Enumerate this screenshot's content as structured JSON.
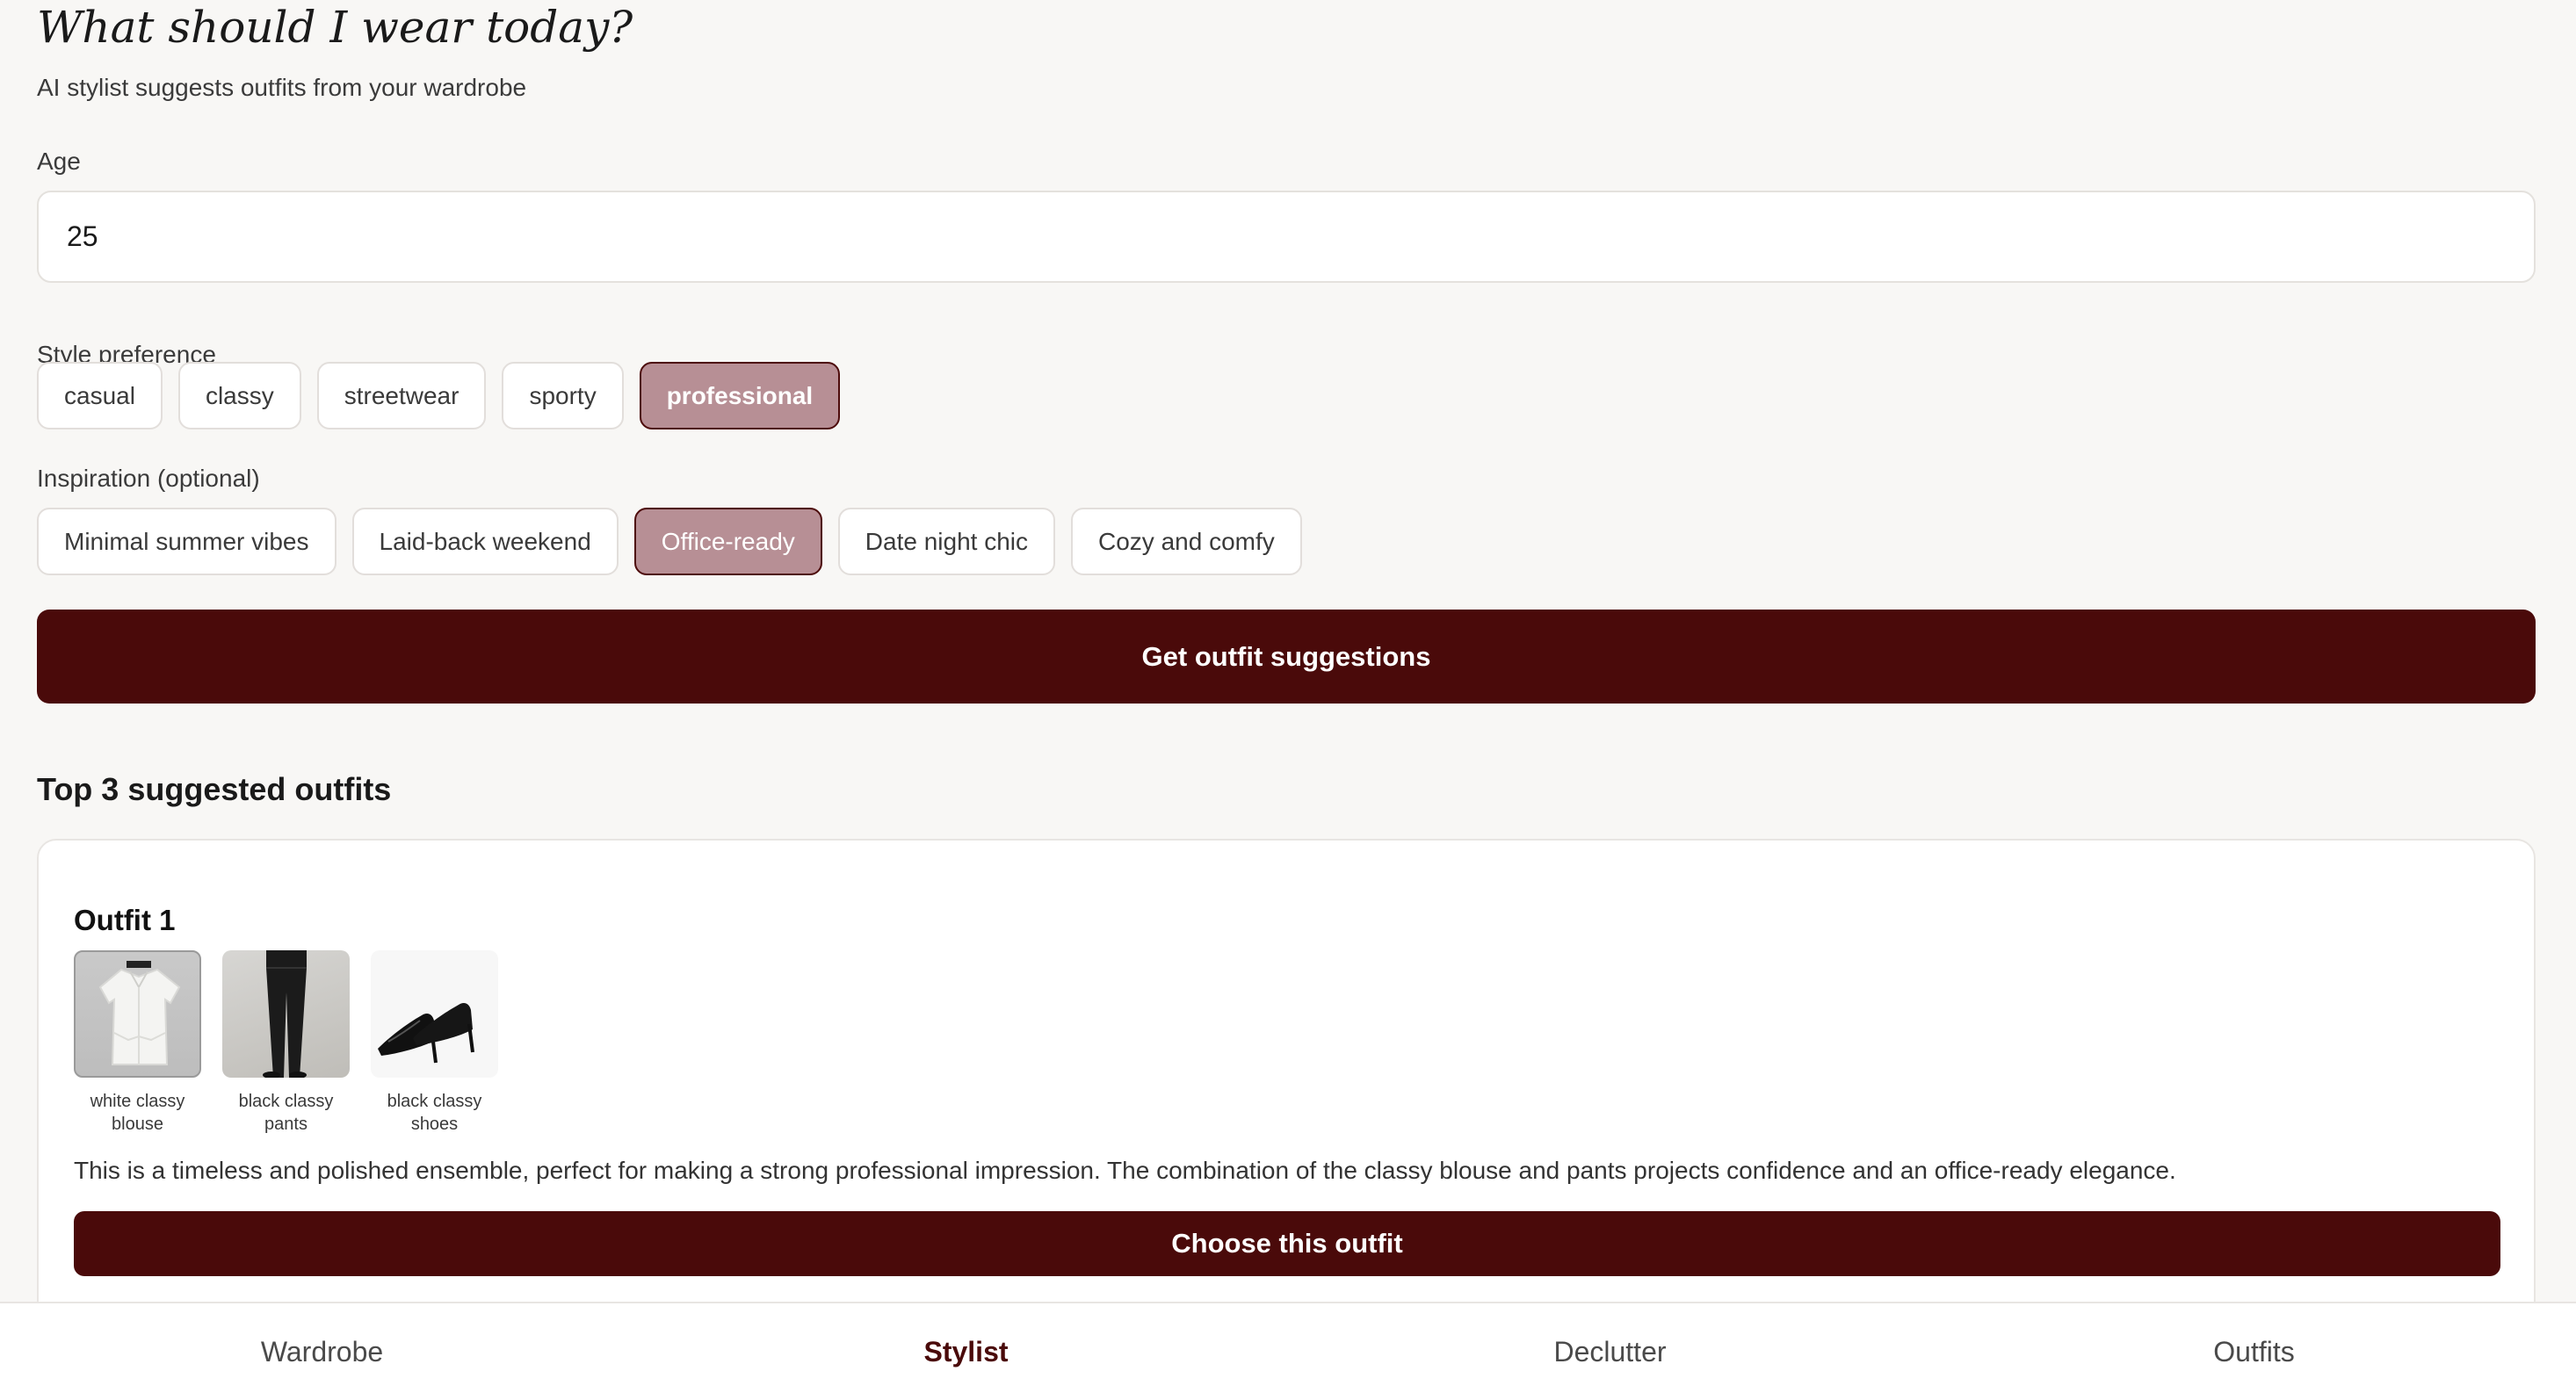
{
  "header": {
    "title": "What should I wear today?",
    "subtitle": "AI stylist suggests outfits from your wardrobe"
  },
  "age": {
    "label": "Age",
    "value": "25"
  },
  "style": {
    "label": "Style preference",
    "options": [
      "casual",
      "classy",
      "streetwear",
      "sporty",
      "professional"
    ],
    "selected": "professional"
  },
  "inspiration": {
    "label": "Inspiration (optional)",
    "options": [
      "Minimal summer vibes",
      "Laid-back weekend",
      "Office-ready",
      "Date night chic",
      "Cozy and comfy"
    ],
    "selected": "Office-ready"
  },
  "actions": {
    "get_suggestions": "Get outfit suggestions"
  },
  "results": {
    "title": "Top 3 suggested outfits",
    "outfits": [
      {
        "title": "Outfit 1",
        "items": [
          {
            "label": "white classy blouse",
            "icon": "blouse-image"
          },
          {
            "label": "black classy pants",
            "icon": "pants-image"
          },
          {
            "label": "black classy shoes",
            "icon": "shoes-image"
          }
        ],
        "description": "This is a timeless and polished ensemble, perfect for making a strong professional impression. The combination of the classy blouse and pants projects confidence and an office-ready elegance.",
        "choose_label": "Choose this outfit"
      }
    ]
  },
  "nav": {
    "items": [
      "Wardrobe",
      "Stylist",
      "Declutter",
      "Outfits"
    ],
    "active": "Stylist"
  },
  "colors": {
    "accent": "#4a0a0a",
    "chip_selected": "#b78f95",
    "background": "#f8f7f5"
  }
}
